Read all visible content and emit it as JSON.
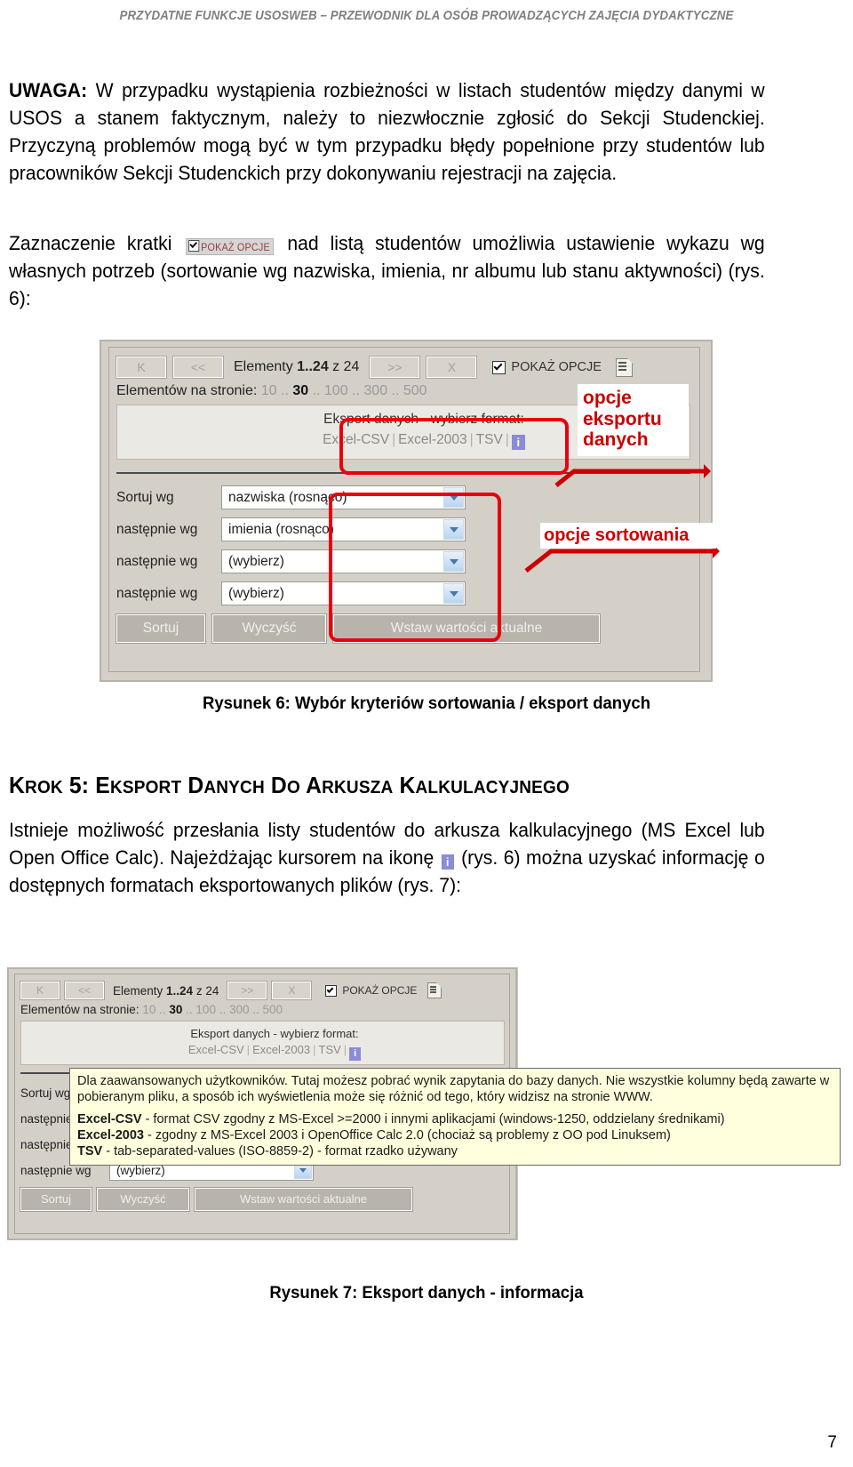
{
  "header": {
    "running_title": "PRZYDATNE FUNKCJE USOSWEB – PRZEWODNIK DLA OSÓB PROWADZĄCYCH ZAJĘCIA DYDAKTYCZNE"
  },
  "page_number": "7",
  "paragraphs": {
    "uwaga_label": "UWAGA:",
    "uwaga_body": " W przypadku wystąpienia rozbieżności w listach studentów między danymi w USOS a stanem faktycznym, należy to niezwłocznie zgłosić do Sekcji Studenckiej. Przyczyną problemów mogą być w tym przypadku błędy popełnione przy studentów lub pracowników Sekcji Studenckich przy dokonywaniu rejestracji na zajęcia.",
    "zaznaczenie_before": "Zaznaczenie kratki ",
    "zaznaczenie_chip_label": "POKAŻ OPCJE",
    "zaznaczenie_after": " nad listą studentów umożliwia ustawienie wykazu wg własnych potrzeb (sortowanie wg nazwiska, imienia, nr albumu lub stanu aktywności) (rys. 6):",
    "istnieje_before": "Istnieje możliwość przesłania listy studentów do arkusza kalkulacyjnego (MS Excel lub Open Office Calc). Najeżdżając kursorem na ikonę ",
    "istnieje_icon": "i",
    "istnieje_after": " (rys. 6) można uzyskać informację o dostępnych formatach eksportowanych plików (rys. 7):"
  },
  "heading_krok5": {
    "k": "K",
    "rok": "ROK",
    "num": " 5: ",
    "e1": "E",
    "ksport": "KSPORT",
    "d1": " D",
    "anych": "ANYCH",
    "d2": " D",
    "o": "O",
    "a1": " A",
    "rkusza": "RKUSZA",
    "k2": " K",
    "alkulacyjnego": "ALKULACYJNEGO"
  },
  "captions": {
    "figure6": "Rysunek 6: Wybór kryteriów sortowania / eksport danych",
    "figure7": "Rysunek 7: Eksport danych - informacja"
  },
  "usosweb_ui": {
    "nav_first": "K",
    "nav_prev": "<<",
    "nav_next": ">>",
    "nav_last": "X",
    "elements_label": "Elementy ",
    "elements_range": "1..24",
    "elements_of": " z 24",
    "show_options_label": "POKAŻ OPCJE",
    "per_page_label": "Elementów na stronie: ",
    "per_page_options": [
      "10",
      "30",
      "100",
      "300",
      "500"
    ],
    "per_page_selected": "30",
    "export_title": "Eksport danych - wybierz format:",
    "export_formats": [
      "Excel-CSV",
      "Excel-2003",
      "TSV"
    ],
    "info_icon_label": "i",
    "sort_rows": [
      {
        "label": "Sortuj wg",
        "value": "nazwiska (rosnąco)"
      },
      {
        "label": "następnie wg",
        "value": "imienia (rosnąco)"
      },
      {
        "label": "następnie wg",
        "value": "(wybierz)"
      },
      {
        "label": "następnie wg",
        "value": "(wybierz)"
      }
    ],
    "buttons": {
      "sort": "Sortuj",
      "clear": "Wyczyść",
      "insert_current": "Wstaw wartości aktualne"
    }
  },
  "annotations": {
    "export_options": "opcje eksportu danych",
    "sort_options": "opcje sortowania",
    "accent_color": "#cc0000",
    "outline_color": "#e8000d"
  },
  "tooltip": {
    "intro": "Dla zaawansowanych użytkowników. Tutaj możesz pobrać wynik zapytania do bazy danych. Nie wszystkie kolumny będą zawarte w pobieranym pliku, a sposób ich wyświetlenia może się różnić od tego, który widzisz na stronie WWW.",
    "csv_name": "Excel-CSV",
    "csv_desc": " - format CSV zgodny z MS-Excel >=2000 i innymi aplikacjami (windows-1250, oddzielany średnikami)",
    "xls_name": "Excel-2003",
    "xls_desc": " - zgodny z MS-Excel 2003 i OpenOffice Calc 2.0 (chociaż są problemy z OO pod Linuksem)",
    "tsv_name": "TSV",
    "tsv_desc": " - tab-separated-values (ISO-8859-2) - format rzadko używany"
  }
}
